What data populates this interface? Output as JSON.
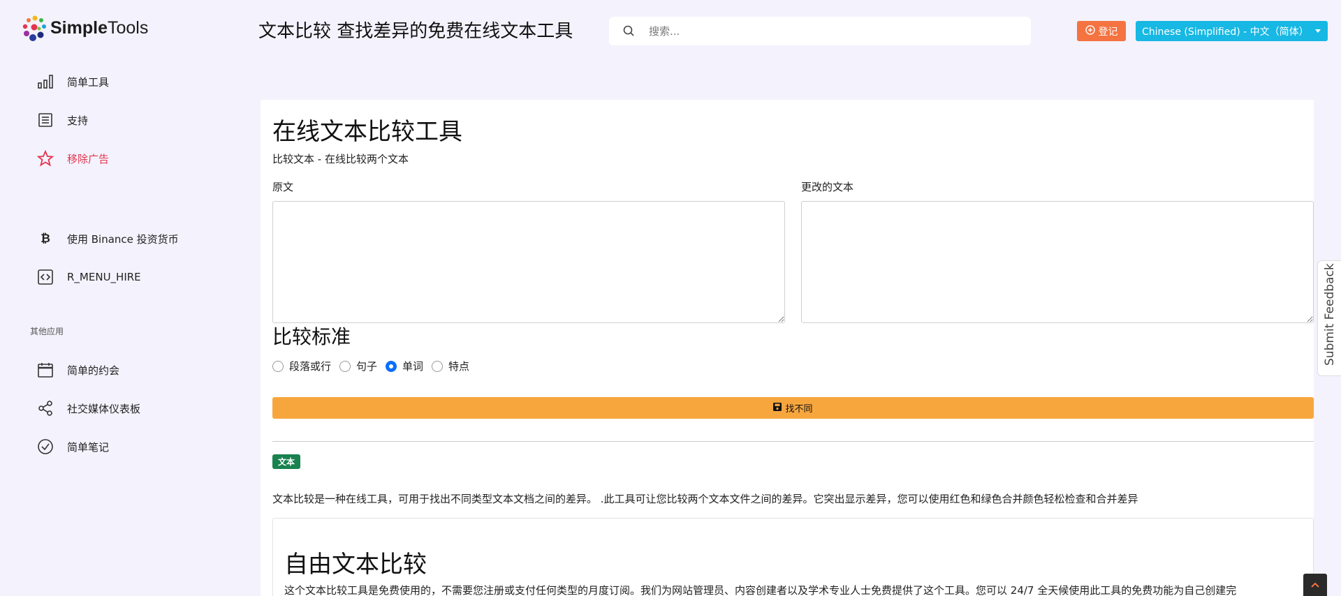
{
  "header": {
    "logo_bold": "Simple",
    "logo_light": "Tools",
    "page_title": "文本比较 查找差异的免费在线文本工具",
    "search_placeholder": "搜索...",
    "login_label": "登记",
    "language_label": "Chinese (Simplified) - 中文（简体）"
  },
  "sidebar": {
    "items": [
      {
        "label": "简单工具",
        "icon": "bar-chart-icon"
      },
      {
        "label": "支持",
        "icon": "document-icon"
      },
      {
        "label": "移除广告",
        "icon": "star-icon"
      },
      {
        "label": "使用 Binance 投资货币",
        "icon": "bitcoin-icon"
      },
      {
        "label": "R_MENU_HIRE",
        "icon": "code-icon"
      }
    ],
    "section_title": "其他应用",
    "apps": [
      {
        "label": "简单的约会",
        "icon": "calendar-icon"
      },
      {
        "label": "社交媒体仪表板",
        "icon": "share-icon"
      },
      {
        "label": "简单笔记",
        "icon": "check-circle-icon"
      }
    ]
  },
  "main": {
    "title": "在线文本比较工具",
    "subtitle": "比较文本 - 在线比较两个文本",
    "original_label": "原文",
    "changed_label": "更改的文本",
    "criteria_title": "比较标准",
    "criteria": [
      "段落或行",
      "句子",
      "单词",
      "特点"
    ],
    "criteria_selected": "单词",
    "find_button": "找不同",
    "badge": "文本",
    "description": "文本比较是一种在线工具，可用于找出不同类型文本文档之间的差异。 .此工具可让您比较两个文本文件之间的差异。它突出显示差异，您可以使用红色和绿色合并颜色轻松检查和合并差异",
    "card_title": "自由文本比较",
    "card_text": "这个文本比较工具是免费使用的，不需要您注册或支付任何类型的月度订阅。我们为网站管理员、内容创建者以及学术专业人士免费提供了这个工具。您可以 24/7 全天候使用此工具的免费功能为自己创建完"
  },
  "feedback_label": "Submit Feedback",
  "colors": {
    "background": "#f4f2fc",
    "login": "#f47340",
    "language": "#17b8e3",
    "find_button": "#f7a63e",
    "badge": "#19824f",
    "accent_red": "#e4354f"
  }
}
